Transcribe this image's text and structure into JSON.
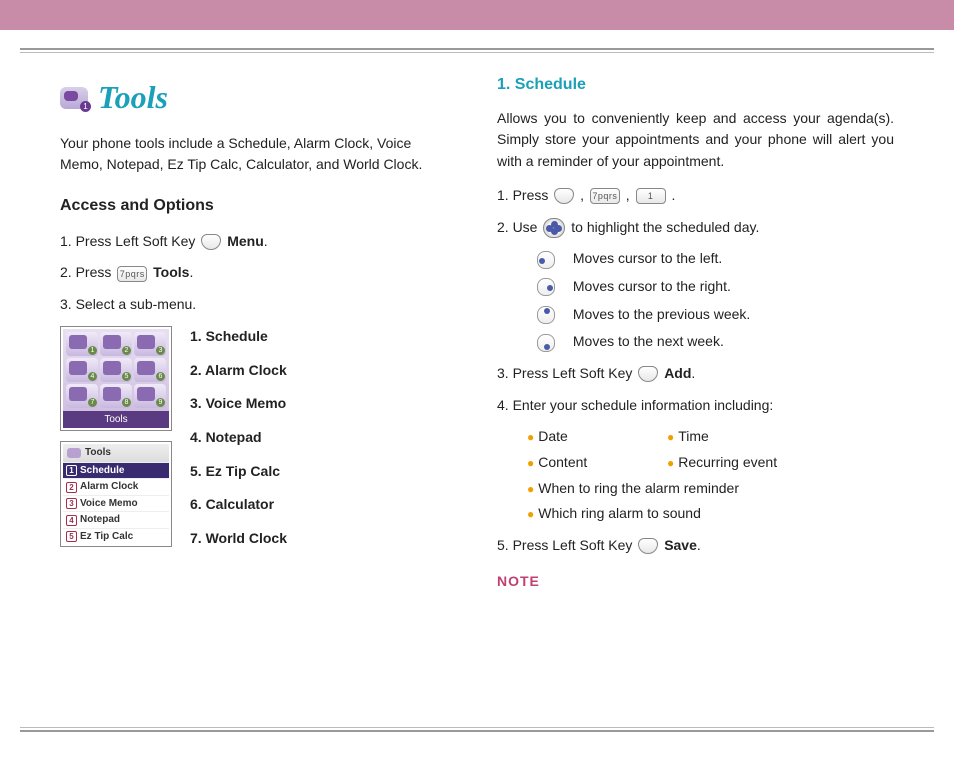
{
  "header": {
    "title": "Tools"
  },
  "left": {
    "intro": "Your phone tools include a Schedule, Alarm Clock, Voice Memo, Notepad, Ez Tip Calc, Calculator, and World Clock.",
    "access_head": "Access and Options",
    "step1_a": "1.  Press Left Soft Key ",
    "step1_b": "Menu",
    "step2_a": "2.  Press ",
    "step2_key": "7pqrs",
    "step2_b": "Tools",
    "step3": "3.  Select a sub-menu.",
    "grid_footer": "Tools",
    "list_header": "Tools",
    "list_rows": {
      "0": {
        "n": "1",
        "t": "Schedule"
      },
      "1": {
        "n": "2",
        "t": "Alarm Clock"
      },
      "2": {
        "n": "3",
        "t": "Voice Memo"
      },
      "3": {
        "n": "4",
        "t": "Notepad"
      },
      "4": {
        "n": "5",
        "t": "Ez Tip Calc"
      }
    },
    "submenu": {
      "0": "1. Schedule",
      "1": "2. Alarm Clock",
      "2": "3. Voice Memo",
      "3": "4. Notepad",
      "4": "5. Ez Tip Calc",
      "5": "6. Calculator",
      "6": "7. World Clock"
    }
  },
  "right": {
    "head": "1. Schedule",
    "intro": "Allows you to conveniently keep and access your agenda(s). Simply store your appointments and your phone will alert you with a reminder of your appointment.",
    "s1_a": "1.  Press ",
    "s1_k2": "7pqrs",
    "s1_k3": "1",
    "s2_a": "2.  Use ",
    "s2_b": " to highlight the scheduled day.",
    "nav": {
      "left": "Moves cursor to the left.",
      "right": "Moves cursor to the right.",
      "up": "Moves to the previous week.",
      "down": "Moves to the next week."
    },
    "s3_a": "3.  Press Left Soft Key ",
    "s3_b": "Add",
    "s4": "4.  Enter your schedule information including:",
    "bul": {
      "date": "Date",
      "time": "Time",
      "content": "Content",
      "recurring": "Recurring event",
      "when": "When to ring the alarm reminder",
      "which": "Which ring alarm to sound"
    },
    "s5_a": "5.  Press Left Soft Key ",
    "s5_b": "Save",
    "note": "NOTE"
  }
}
